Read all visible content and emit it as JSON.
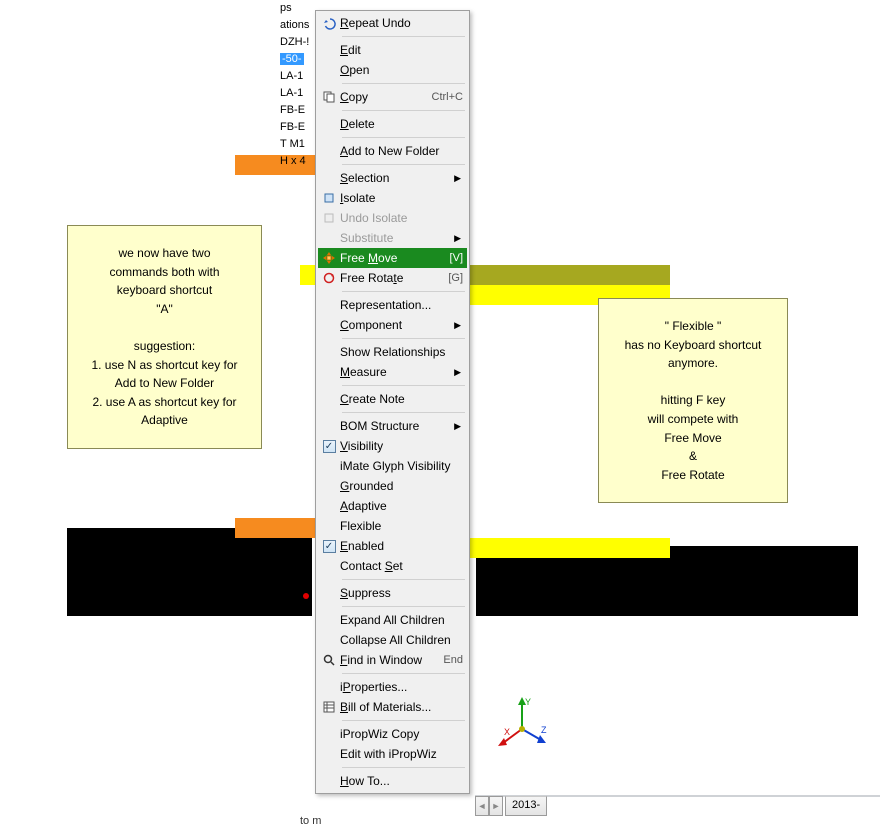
{
  "tree": {
    "items": [
      "ps",
      "ations",
      "",
      "DZH-!",
      "-50-",
      "LA-1",
      "LA-1",
      "FB-E",
      "FB-E",
      "T M1",
      "H x 4"
    ]
  },
  "menu": [
    {
      "type": "item",
      "id": "repeat-undo",
      "label": "Repeat Undo",
      "u": 0,
      "icon": "undo"
    },
    {
      "type": "sep"
    },
    {
      "type": "item",
      "id": "edit",
      "label": "Edit",
      "u": 0
    },
    {
      "type": "item",
      "id": "open",
      "label": "Open",
      "u": 0
    },
    {
      "type": "sep"
    },
    {
      "type": "item",
      "id": "copy",
      "label": "Copy",
      "u": 0,
      "icon": "copy",
      "shortcut": "Ctrl+C"
    },
    {
      "type": "sep"
    },
    {
      "type": "item",
      "id": "delete",
      "label": "Delete",
      "u": 0
    },
    {
      "type": "sep"
    },
    {
      "type": "item",
      "id": "add-to-new-folder",
      "label": "Add to New Folder",
      "u": 0
    },
    {
      "type": "sep"
    },
    {
      "type": "item",
      "id": "selection",
      "label": "Selection",
      "u": 0,
      "submenu": true
    },
    {
      "type": "item",
      "id": "isolate",
      "label": "Isolate",
      "u": 0,
      "icon": "isolate"
    },
    {
      "type": "item",
      "id": "undo-isolate",
      "label": "Undo Isolate",
      "icon": "undo-isolate",
      "disabled": true
    },
    {
      "type": "item",
      "id": "substitute",
      "label": "Substitute",
      "disabled": true,
      "submenu": true
    },
    {
      "type": "item",
      "id": "free-move",
      "label": "Free Move",
      "u": 5,
      "icon": "freemove",
      "shortcut": "[V]",
      "hl": "green"
    },
    {
      "type": "item",
      "id": "free-rotate",
      "label": "Free Rotate",
      "u": 9,
      "icon": "freerotate",
      "shortcut": "[G]"
    },
    {
      "type": "sep"
    },
    {
      "type": "item",
      "id": "representation",
      "label": "Representation..."
    },
    {
      "type": "item",
      "id": "component",
      "label": "Component",
      "u": 0,
      "submenu": true
    },
    {
      "type": "sep"
    },
    {
      "type": "item",
      "id": "show-relationships",
      "label": "Show Relationships"
    },
    {
      "type": "item",
      "id": "measure",
      "label": "Measure",
      "u": 0,
      "submenu": true
    },
    {
      "type": "sep"
    },
    {
      "type": "item",
      "id": "create-note",
      "label": "Create Note",
      "u": 0
    },
    {
      "type": "sep"
    },
    {
      "type": "item",
      "id": "bom-structure",
      "label": "BOM Structure",
      "submenu": true
    },
    {
      "type": "item",
      "id": "visibility",
      "label": "Visibility",
      "u": 0,
      "check": true
    },
    {
      "type": "item",
      "id": "imate-glyph-visibility",
      "label": "iMate Glyph Visibility"
    },
    {
      "type": "item",
      "id": "grounded",
      "label": "Grounded",
      "u": 0
    },
    {
      "type": "item",
      "id": "adaptive",
      "label": "Adaptive",
      "u": 0
    },
    {
      "type": "item",
      "id": "flexible",
      "label": "Flexible"
    },
    {
      "type": "item",
      "id": "enabled",
      "label": "Enabled",
      "u": 0,
      "check": true
    },
    {
      "type": "item",
      "id": "contact-set",
      "label": "Contact Set",
      "u": 8
    },
    {
      "type": "sep"
    },
    {
      "type": "item",
      "id": "suppress",
      "label": "Suppress",
      "u": 0
    },
    {
      "type": "sep"
    },
    {
      "type": "item",
      "id": "expand-all-children",
      "label": "Expand All Children"
    },
    {
      "type": "item",
      "id": "collapse-all-children",
      "label": "Collapse All Children"
    },
    {
      "type": "item",
      "id": "find-in-window",
      "label": "Find in Window",
      "u": 0,
      "icon": "find",
      "shortcut": "End"
    },
    {
      "type": "sep"
    },
    {
      "type": "item",
      "id": "iproperties",
      "label": "iProperties...",
      "u": 1
    },
    {
      "type": "item",
      "id": "bill-of-materials",
      "label": "Bill of Materials...",
      "u": 0,
      "icon": "bom"
    },
    {
      "type": "sep"
    },
    {
      "type": "item",
      "id": "ipropwiz-copy",
      "label": "iPropWiz Copy"
    },
    {
      "type": "item",
      "id": "edit-with-ipropwiz",
      "label": "Edit with iPropWiz"
    },
    {
      "type": "sep"
    },
    {
      "type": "item",
      "id": "how-to",
      "label": "How To...",
      "u": 0
    }
  ],
  "callout_left": {
    "lines": [
      "we now have two",
      "commands both with",
      "keyboard shortcut",
      "\"A\"",
      "",
      "suggestion:",
      "1. use N as shortcut key for",
      "Add to New Folder",
      "2. use A as shortcut key for",
      "Adaptive"
    ]
  },
  "callout_right": {
    "lines": [
      "\" Flexible \"",
      "has no Keyboard shortcut",
      "anymore.",
      "",
      "hitting F key",
      "will compete with",
      "Free Move",
      "&",
      "Free Rotate"
    ]
  },
  "bottom": {
    "tab": "2013-",
    "label": "to m"
  },
  "axes": {
    "x": "X",
    "y": "Y",
    "z": "Z"
  }
}
